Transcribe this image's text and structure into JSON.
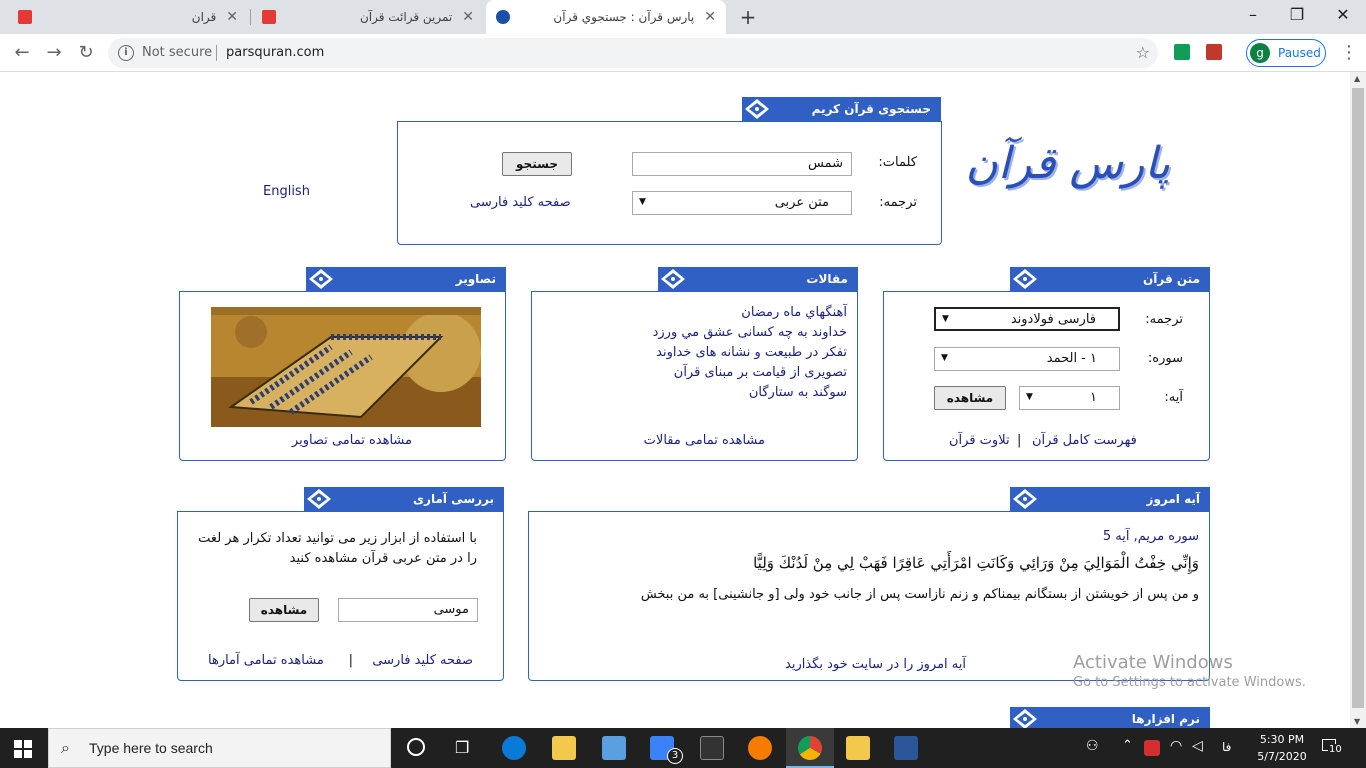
{
  "browser": {
    "tabs": [
      {
        "title": "قران",
        "active": false
      },
      {
        "title": "تمرين قرائت قرآن",
        "active": false
      },
      {
        "title": "پارس قرآن : جستجوي قرآن",
        "active": true
      }
    ],
    "url_security": "Not secure",
    "url": "parsquran.com",
    "profile_initial": "g",
    "profile_status": "Paused"
  },
  "site": {
    "logo_text": "پارس قرآن",
    "english_link": "English"
  },
  "search": {
    "header": "جستجوی قرآن کریم",
    "words_label": "کلمات:",
    "words_value": "شمس",
    "search_button": "جستجو",
    "translation_label": "ترجمه:",
    "translation_value": "متن عربی",
    "keyword_link": "صفحه کلید فارسی"
  },
  "quran_text": {
    "header": "متن قرآن",
    "translation_label": "ترجمه:",
    "translation_value": "فارسی فولادوند",
    "sura_label": "سوره:",
    "sura_value": "۱ - الحمد",
    "aya_label": "آیه:",
    "aya_value": "۱",
    "view_button": "مشاهده",
    "index_link": "فهرست کامل قرآن",
    "divider": "|",
    "recitation_link": "تلاوت قرآن"
  },
  "articles": {
    "header": "مقالات",
    "items": [
      "آهنگهاي ماه رمضان",
      "خداوند به چه کسانی عشق مي ورزد",
      "تفکر در طبیعت و نشانه های خداوند",
      "تصویری از قیامت بر مبنای قرآن",
      "سوگند به ستارگان"
    ],
    "all_link": "مشاهده تمامی مقالات"
  },
  "images": {
    "header": "تصاویر",
    "all_link": "مشاهده تمامی تصاویر"
  },
  "verse_today": {
    "header": "آیه امروز",
    "reference": "سوره مریم, آیه 5",
    "arabic": "وَإِنِّي خِفْتُ الْمَوَالِيَ مِنْ وَرَائِي وَكَانَتِ امْرَأَتِي عَاقِرًا فَهَبْ لِي مِنْ لَدُنْكَ وَلِيًّا",
    "translation": "و من پس از خویشتن از بستگانم بیمناکم و زنم نازاست پس از جانب خود ولی [و جانشینی] به من ببخش",
    "embed_link": "آیه امروز را در سایت خود بگذارید"
  },
  "stats": {
    "header": "بررسی آماری",
    "description": "با استفاده از ابزار زیر می توانید تعداد تکرار هر لغت را در متن عربی قرآن مشاهده کنید",
    "input_value": "موسی",
    "view_button": "مشاهده",
    "keyboard_link": "صفحه کلید فارسی",
    "divider": "|",
    "all_link": "مشاهده تمامی آمارها"
  },
  "software": {
    "header": "نرم افزارها"
  },
  "watermark": {
    "title": "Activate Windows",
    "subtitle": "Go to Settings to activate Windows."
  },
  "taskbar": {
    "search_placeholder": "Type here to search",
    "mail_badge": "3",
    "lang": "فا",
    "time": "5:30 PM",
    "date": "5/7/2020",
    "notif_count": "10"
  }
}
